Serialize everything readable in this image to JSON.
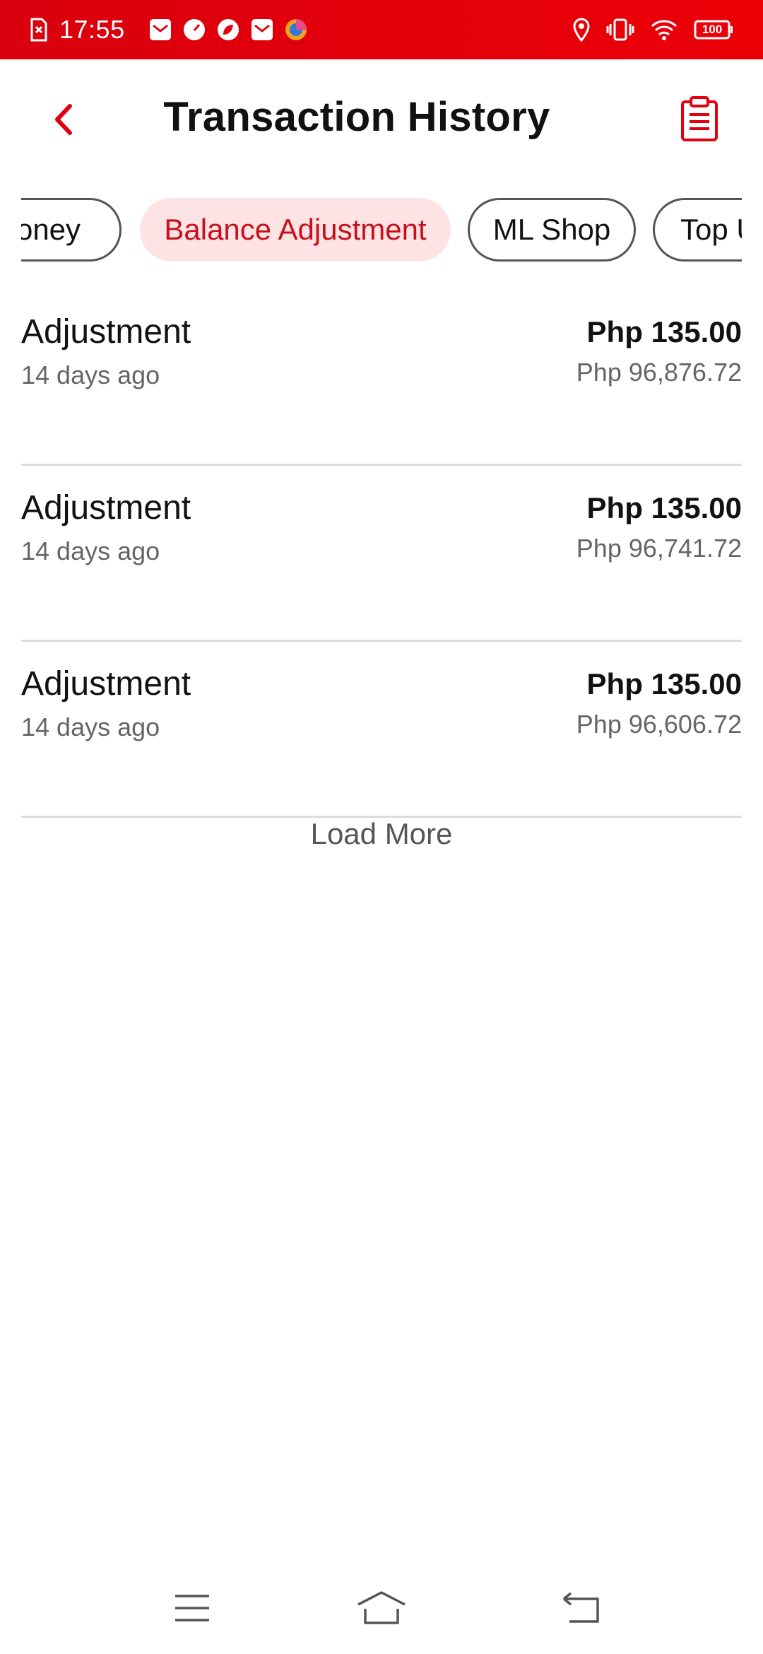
{
  "status_bar": {
    "time": "17:55",
    "battery": "100",
    "left_icons": [
      "sim-error-icon",
      "mail-icon",
      "speed-icon",
      "leaf-icon",
      "mail-icon",
      "browser-icon"
    ],
    "right_icons": [
      "location-icon",
      "vibrate-icon",
      "wifi-icon",
      "battery-icon"
    ]
  },
  "header": {
    "title": "Transaction History",
    "back_icon": "chevron-left-icon",
    "action_icon": "clipboard-icon",
    "accent_color": "#e3000f"
  },
  "filters": {
    "chips": [
      {
        "label": "Money",
        "visible_text": "Money",
        "active": false
      },
      {
        "label": "Balance Adjustment",
        "active": true
      },
      {
        "label": "ML Shop",
        "active": false
      },
      {
        "label": "Top Up",
        "active": false
      }
    ]
  },
  "transactions": [
    {
      "title": "Adjustment",
      "time": "14 days ago",
      "amount": "Php 135.00",
      "balance": "Php 96,876.72"
    },
    {
      "title": "Adjustment",
      "time": "14 days ago",
      "amount": "Php 135.00",
      "balance": "Php 96,741.72"
    },
    {
      "title": "Adjustment",
      "time": "14 days ago",
      "amount": "Php 135.00",
      "balance": "Php 96,606.72"
    }
  ],
  "load_more_label": "Load More",
  "nav_bar": {
    "icons": [
      "menu-icon",
      "home-icon",
      "back-icon"
    ]
  }
}
